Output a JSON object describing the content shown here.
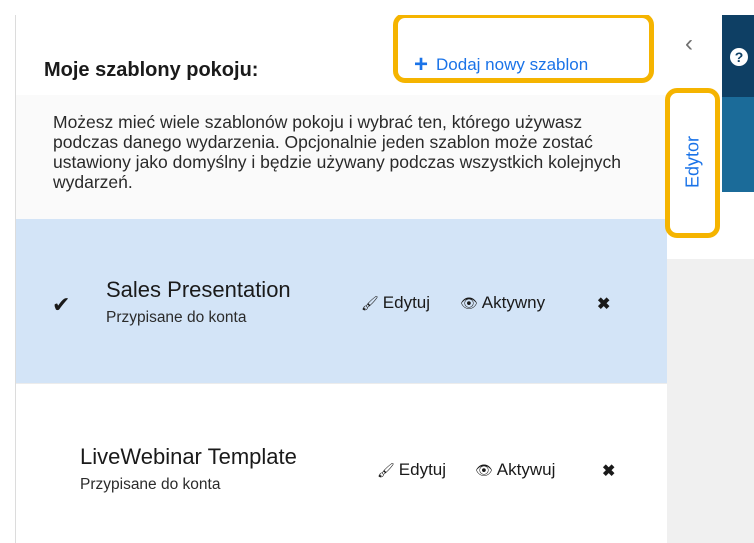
{
  "header": {
    "title": "Moje szablony pokoju:",
    "add_label": "Dodaj nowy szablon",
    "add_icon": "plus-icon"
  },
  "description": "Możesz mieć wiele szablonów pokoju i wybrać ten, którego używasz podczas danego wydarzenia. Opcjonalnie jeden szablon może zostać ustawiony jako domyślny i będzie używany podczas wszystkich kolejnych wydarzeń.",
  "templates": [
    {
      "name": "Sales Presentation",
      "subtitle": "Przypisane do konta",
      "selected": true,
      "edit_label": "Edytuj",
      "status_label": "Aktywny"
    },
    {
      "name": "LiveWebinar Template",
      "subtitle": "Przypisane do konta",
      "selected": false,
      "edit_label": "Edytuj",
      "status_label": "Aktywuj"
    }
  ],
  "sidebar": {
    "editor_tab": "Edytor",
    "collapse_icon": "chevron-left-icon",
    "help_icon": "help-icon"
  },
  "colors": {
    "accent": "#1a73e8",
    "highlight": "#f5b400",
    "selected_row": "#d3e4f7"
  }
}
